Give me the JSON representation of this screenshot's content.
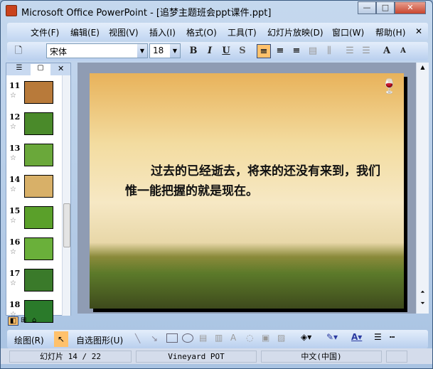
{
  "window": {
    "title": "Microsoft Office PowerPoint - [追梦主题班会ppt课件.ppt]",
    "minimize": "—",
    "maximize": "□",
    "close": "✕"
  },
  "menu": {
    "items": [
      "文件(F)",
      "编辑(E)",
      "视图(V)",
      "插入(I)",
      "格式(O)",
      "工具(T)",
      "幻灯片放映(D)",
      "窗口(W)",
      "帮助(H)"
    ],
    "close": "✕"
  },
  "toolbar": {
    "font": "宋体",
    "size": "18",
    "bold": "B",
    "italic": "I",
    "underline": "U",
    "shadow": "S",
    "align_left": "≡",
    "align_center": "≡",
    "align_right": "≡",
    "grow": "A",
    "shrink": "A"
  },
  "pane": {
    "tab_close": "✕",
    "slides": [
      {
        "n": "11",
        "color": "#b87a3a"
      },
      {
        "n": "12",
        "color": "#4a8a2a"
      },
      {
        "n": "13",
        "color": "#6aa83a"
      },
      {
        "n": "14",
        "color": "#d8b068"
      },
      {
        "n": "15",
        "color": "#5aa02a"
      },
      {
        "n": "16",
        "color": "#6ab03a"
      },
      {
        "n": "17",
        "color": "#3a7a2a"
      },
      {
        "n": "18",
        "color": "#2a7a2a"
      }
    ],
    "star": "☆"
  },
  "slide": {
    "text": "过去的已经逝去，将来的还没有来到，我们惟一能把握的就是现在。"
  },
  "drawbar": {
    "draw": "绘图(R)",
    "autoshapes": "自选图形(U)"
  },
  "status": {
    "slide": "幻灯片 14 / 22",
    "design": "Vineyard POT",
    "language": "中文(中国)"
  }
}
